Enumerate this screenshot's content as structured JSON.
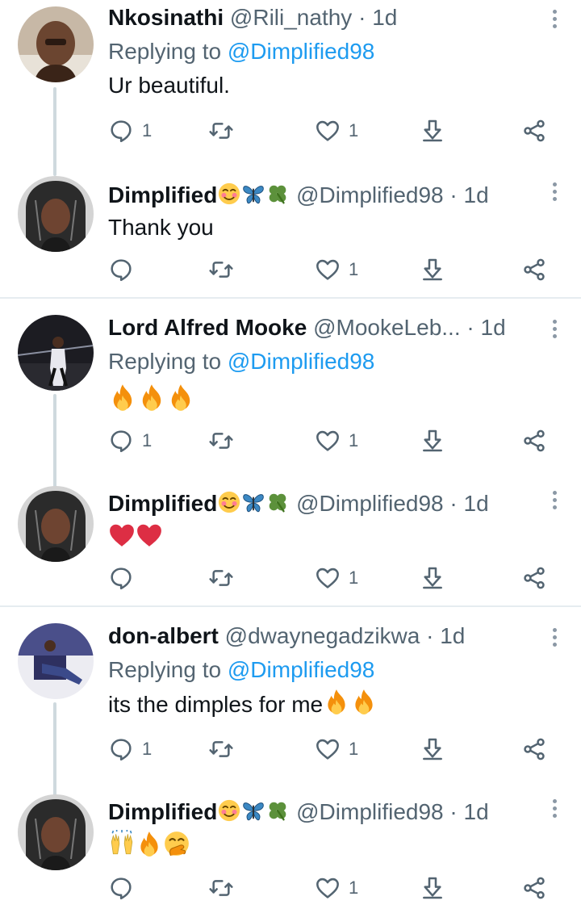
{
  "colors": {
    "name": "#0f1419",
    "secondary": "#536471",
    "mention": "#1d9bf0",
    "icon": "#536471",
    "divider": "#e6ecf0"
  },
  "tweets": [
    {
      "name": "Nkosinathi",
      "handle": "@Rili_nathy",
      "dot": "·",
      "time": "1d",
      "replying_prefix": "Replying to",
      "replying_to": "@Dimplified98",
      "text": "Ur beautiful.",
      "reply_count": "1",
      "like_count": "1"
    },
    {
      "name": "Dimplified",
      "handle": "@Dimplified98",
      "dot": "·",
      "time": "1d",
      "name_emojis": [
        "blush-emoji",
        "butterfly-emoji",
        "clover-emoji"
      ],
      "text": "Thank you",
      "reply_count": "",
      "like_count": "1"
    },
    {
      "name": "Lord Alfred Mooke",
      "handle": "@MookeLeb...",
      "dot": "·",
      "time": "1d",
      "replying_prefix": "Replying to",
      "replying_to": "@Dimplified98",
      "text_emojis": [
        "fire-emoji",
        "fire-emoji",
        "fire-emoji"
      ],
      "reply_count": "1",
      "like_count": "1"
    },
    {
      "name": "Dimplified",
      "handle": "@Dimplified98",
      "dot": "·",
      "time": "1d",
      "name_emojis": [
        "blush-emoji",
        "butterfly-emoji",
        "clover-emoji"
      ],
      "text_emojis": [
        "red-heart-emoji",
        "red-heart-emoji"
      ],
      "reply_count": "",
      "like_count": "1"
    },
    {
      "name": "don-albert",
      "handle": "@dwaynegadzikwa",
      "dot": "·",
      "time": "1d",
      "replying_prefix": "Replying to",
      "replying_to": "@Dimplified98",
      "text": "its the dimples for me",
      "text_emojis": [
        "fire-emoji",
        "fire-emoji"
      ],
      "reply_count": "1",
      "like_count": "1"
    },
    {
      "name": "Dimplified",
      "handle": "@Dimplified98",
      "dot": "·",
      "time": "1d",
      "name_emojis": [
        "blush-emoji",
        "butterfly-emoji",
        "clover-emoji"
      ],
      "text_emojis": [
        "raised-hands-emoji",
        "fire-emoji",
        "hand-over-mouth-emoji"
      ],
      "reply_count": "",
      "like_count": "1"
    }
  ]
}
